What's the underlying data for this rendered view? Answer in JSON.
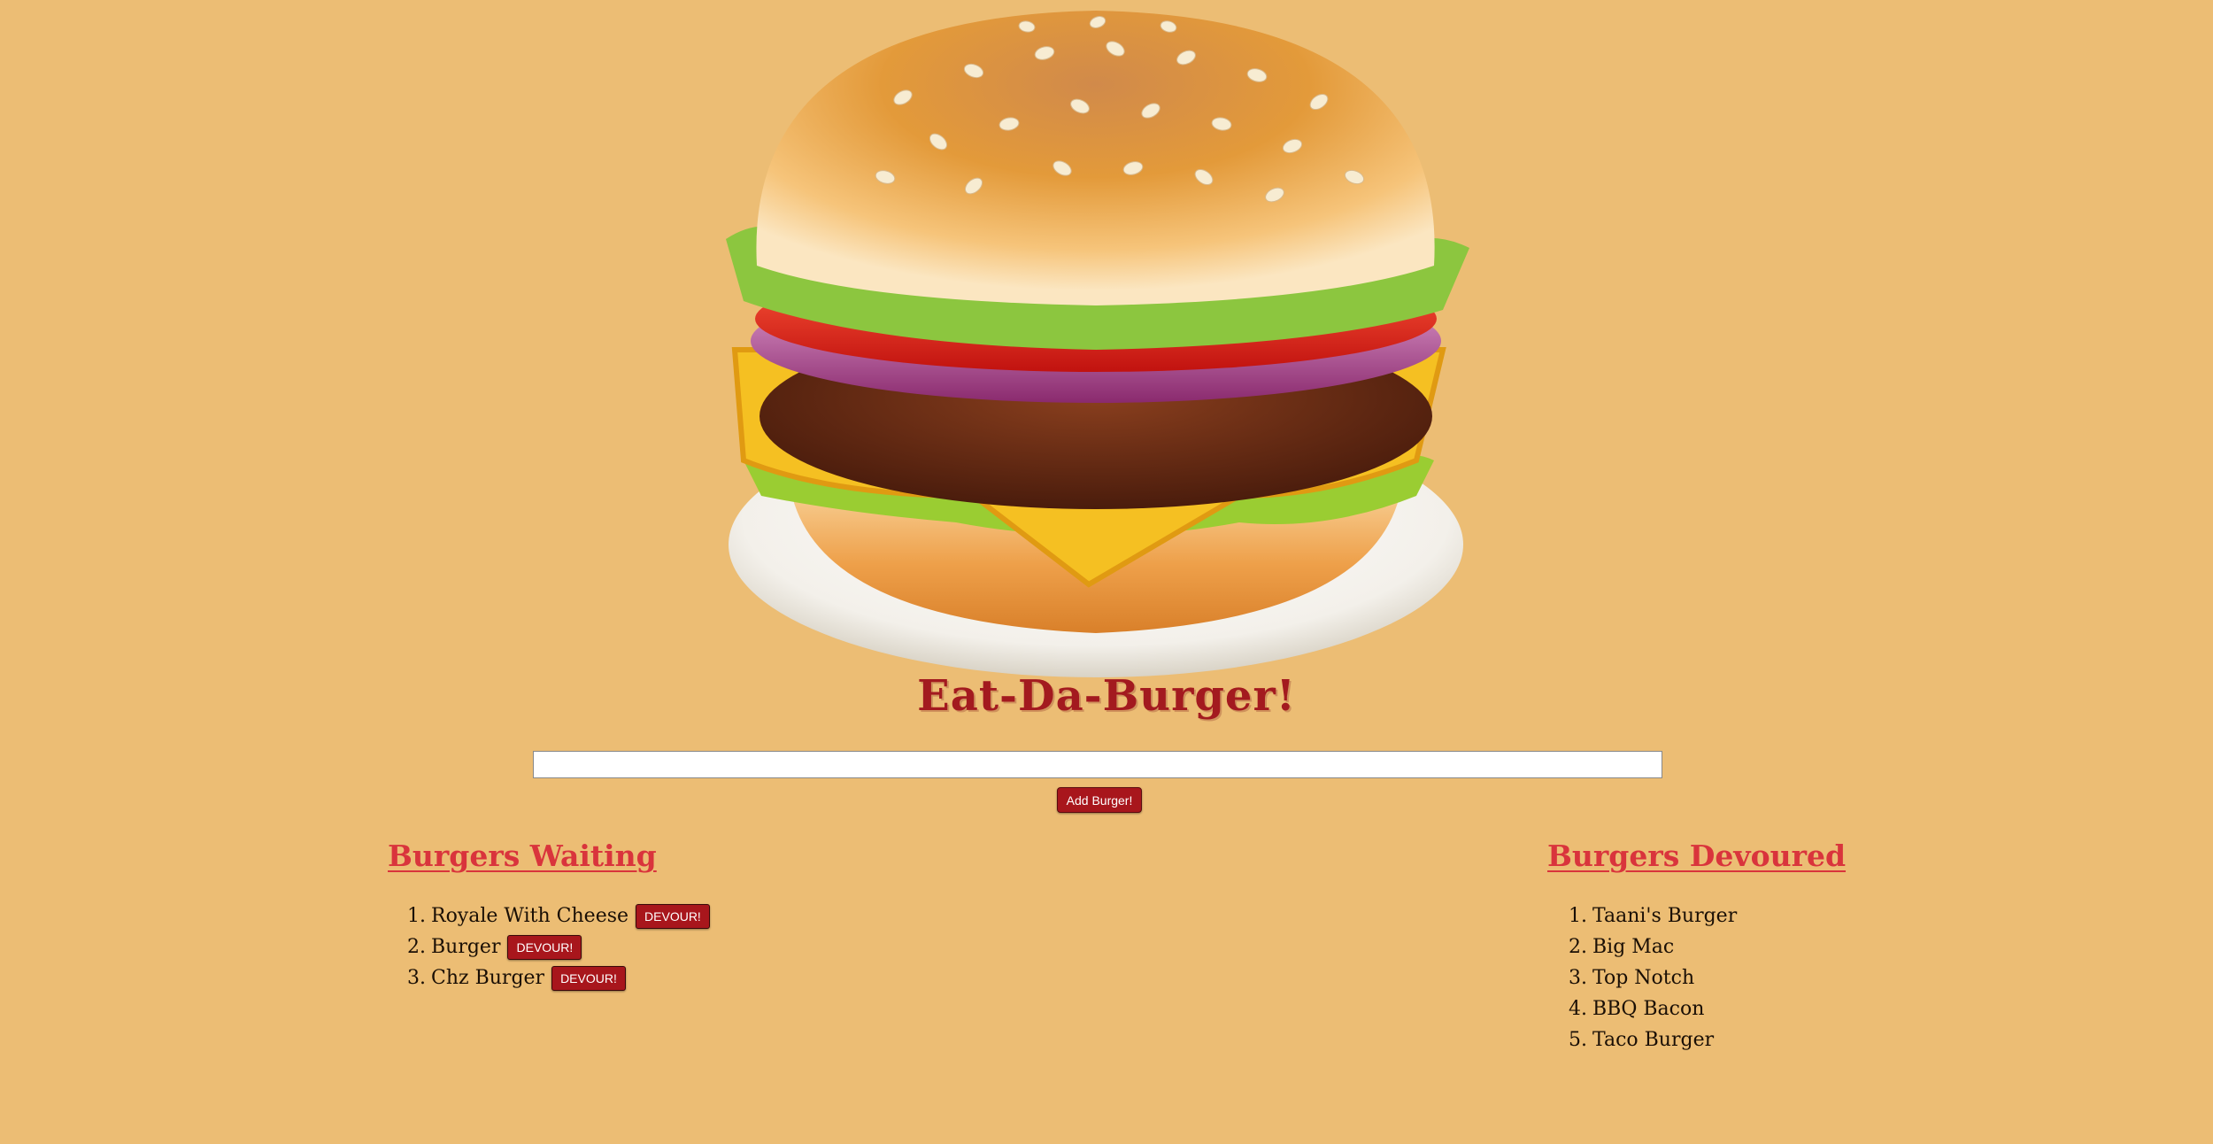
{
  "header": {
    "title": "Eat-Da-Burger!",
    "image_icon": "burger-illustration"
  },
  "form": {
    "input_value": "",
    "add_button_label": "Add Burger!"
  },
  "waiting": {
    "heading": "Burgers Waiting",
    "button_label": "DEVOUR!",
    "items": [
      {
        "num": "1.",
        "name": "Royale With Cheese"
      },
      {
        "num": "2.",
        "name": "Burger"
      },
      {
        "num": "3.",
        "name": "Chz Burger"
      }
    ]
  },
  "devoured": {
    "heading": "Burgers Devoured",
    "items": [
      {
        "num": "1.",
        "name": "Taani's Burger"
      },
      {
        "num": "2.",
        "name": "Big Mac"
      },
      {
        "num": "3.",
        "name": "Top Notch"
      },
      {
        "num": "4.",
        "name": "BBQ Bacon"
      },
      {
        "num": "5.",
        "name": "Taco Burger"
      }
    ]
  },
  "colors": {
    "background": "#ecbd74",
    "title": "#a31a1f",
    "heading": "#d9343c",
    "button": "#a8161c"
  }
}
